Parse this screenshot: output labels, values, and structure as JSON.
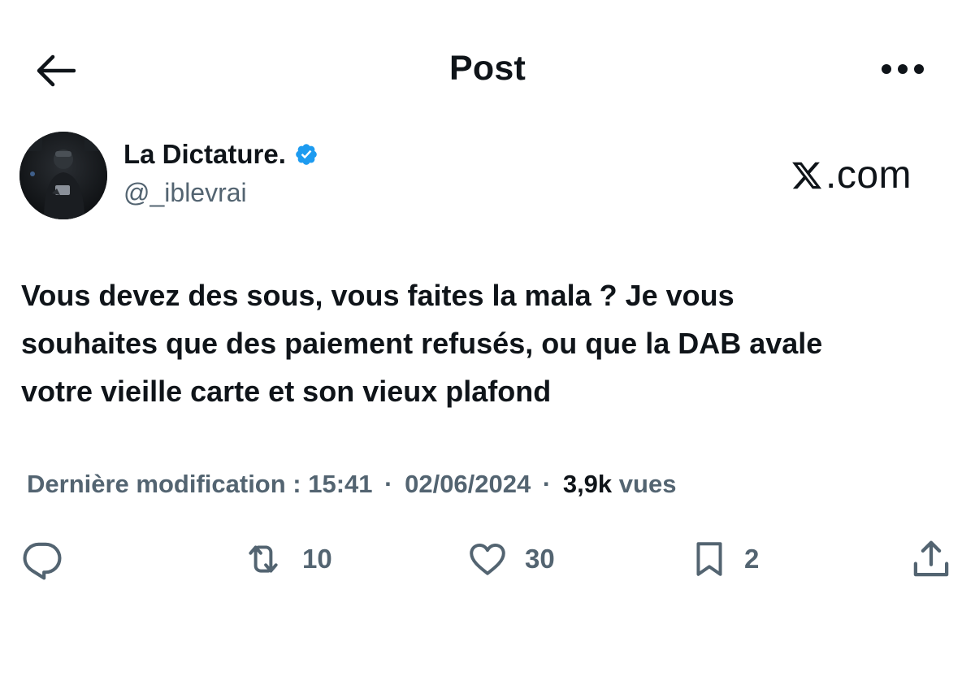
{
  "header": {
    "title": "Post"
  },
  "author": {
    "display_name": "La Dictature.",
    "handle": "@_iblevrai",
    "verified": true
  },
  "watermark": {
    "suffix": ".com"
  },
  "tweet": {
    "lines": [
      "Vous devez des sous, vous faites la mala ? Je vous",
      "souhaites que des paiement refusés, ou que la DAB avale",
      "votre vieille carte et son vieux plafond"
    ]
  },
  "meta": {
    "edited_label": "Dernière modification : 15:41",
    "separator": "·",
    "date": "02/06/2024",
    "separator2": "·",
    "views_count": "3,9k",
    "views_label": "vues"
  },
  "actions": {
    "retweets": "10",
    "likes": "30",
    "bookmarks": "2"
  },
  "colors": {
    "text": "#0f1419",
    "secondary": "#536471",
    "verified": "#1d9bf0"
  }
}
